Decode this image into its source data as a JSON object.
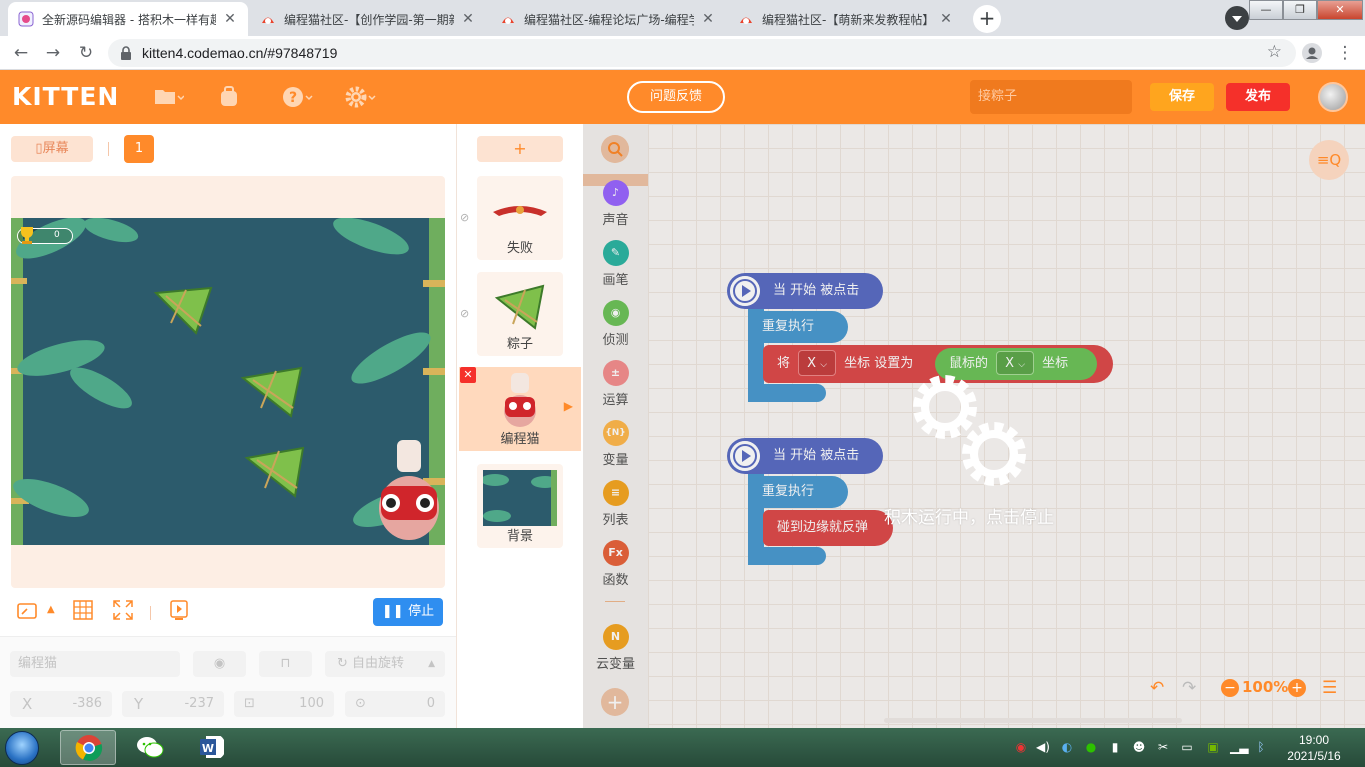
{
  "browser": {
    "tabs": [
      {
        "title": "全新源码编辑器 - 搭积木一样有趣",
        "active": true
      },
      {
        "title": "编程猫社区-【创作学园-第一期新",
        "active": false
      },
      {
        "title": "编程猫社区-编程论坛广场-编程学",
        "active": false
      },
      {
        "title": "编程猫社区-【萌新来发教程帖】",
        "active": false
      }
    ],
    "new_tab": "+",
    "url": "kitten4.codemao.cn/#97848719",
    "window_buttons": [
      "—",
      "❐",
      "✕"
    ]
  },
  "header": {
    "logo": "KITTEN",
    "feedback": "问题反馈",
    "search_value": "接粽子",
    "save": "保存",
    "publish": "发布"
  },
  "stage": {
    "screen_btn": "屏幕",
    "page_num": "1",
    "score": "0",
    "stop": "停止"
  },
  "props": {
    "name_placeholder": "编程猫",
    "rotation": "自由旋转",
    "x_label": "X",
    "x_value": "-386",
    "y_label": "Y",
    "y_value": "-237",
    "size_value": "100",
    "direction_value": "0"
  },
  "sprites": {
    "add": "+",
    "items": [
      {
        "name": "失败"
      },
      {
        "name": "粽子"
      },
      {
        "name": "编程猫"
      },
      {
        "name": "背景"
      }
    ]
  },
  "palette": {
    "items": [
      {
        "label": "声音",
        "icon": "♪",
        "color": "#9966ff"
      },
      {
        "label": "画笔",
        "icon": "✎",
        "color": "#2db5a3"
      },
      {
        "label": "侦测",
        "icon": "◉",
        "color": "#6ec35a"
      },
      {
        "label": "运算",
        "icon": "±",
        "color": "#f58f8f"
      },
      {
        "label": "变量",
        "icon": "{N}",
        "color": "#ffb84d"
      },
      {
        "label": "列表",
        "icon": "≡",
        "color": "#f5a623"
      },
      {
        "label": "函数",
        "icon": "Fx",
        "color": "#e8643c"
      },
      {
        "label": "云变量",
        "icon": "N",
        "color": "#f5a623"
      }
    ],
    "add": "+"
  },
  "workspace": {
    "script1": {
      "hat": "当 开始 被点击",
      "loop": "重复执行",
      "set_prefix": "将",
      "set_axis": "X",
      "set_mid": "坐标 设置为",
      "mouse_prefix": "鼠标的",
      "mouse_axis": "X",
      "mouse_suffix": "坐标"
    },
    "script2": {
      "hat": "当 开始 被点击",
      "loop": "重复执行",
      "bounce": "碰到边缘就反弹"
    },
    "running_message": "积木运行中，点击停止",
    "zoom": "100%"
  },
  "taskbar": {
    "time": "19:00",
    "date": "2021/5/16"
  },
  "colors": {
    "brand": "#ff8a2a",
    "save": "#ffa51e",
    "publish": "#f5302a",
    "event_block": "#5b6dc4",
    "control_block": "#4b9bd1",
    "motion_block": "#de4b4b",
    "sensor_block": "#6ec35a"
  }
}
